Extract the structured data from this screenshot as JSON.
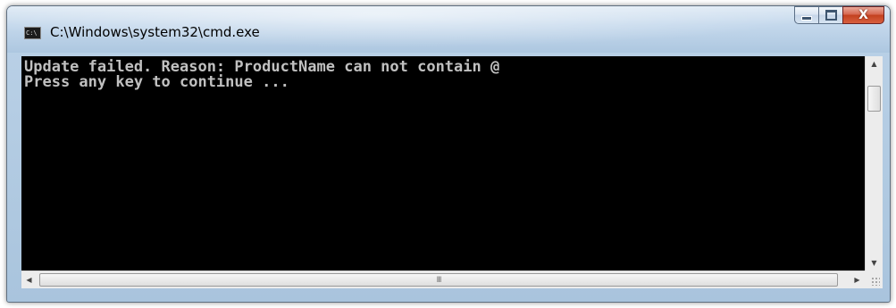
{
  "window": {
    "title": "C:\\Windows\\system32\\cmd.exe",
    "icon": "cmd-console-icon",
    "icon_text": "C:\\",
    "caption_buttons": {
      "minimize_icon": "minimize-icon",
      "maximize_icon": "maximize-icon",
      "close_icon": "close-icon",
      "close_glyph": "X"
    }
  },
  "console": {
    "lines": [
      "Update failed. Reason: ProductName can not contain @",
      "Press any key to continue ..."
    ],
    "text_color": "#c0c0c0",
    "background_color": "#000000"
  },
  "scrollbars": {
    "vertical": {
      "up_glyph": "▲",
      "down_glyph": "▼"
    },
    "horizontal": {
      "left_glyph": "◀",
      "right_glyph": "▶",
      "grip": "III"
    }
  },
  "colors": {
    "close_button": "#c8452a",
    "titlebar": "#c4d8ec"
  }
}
